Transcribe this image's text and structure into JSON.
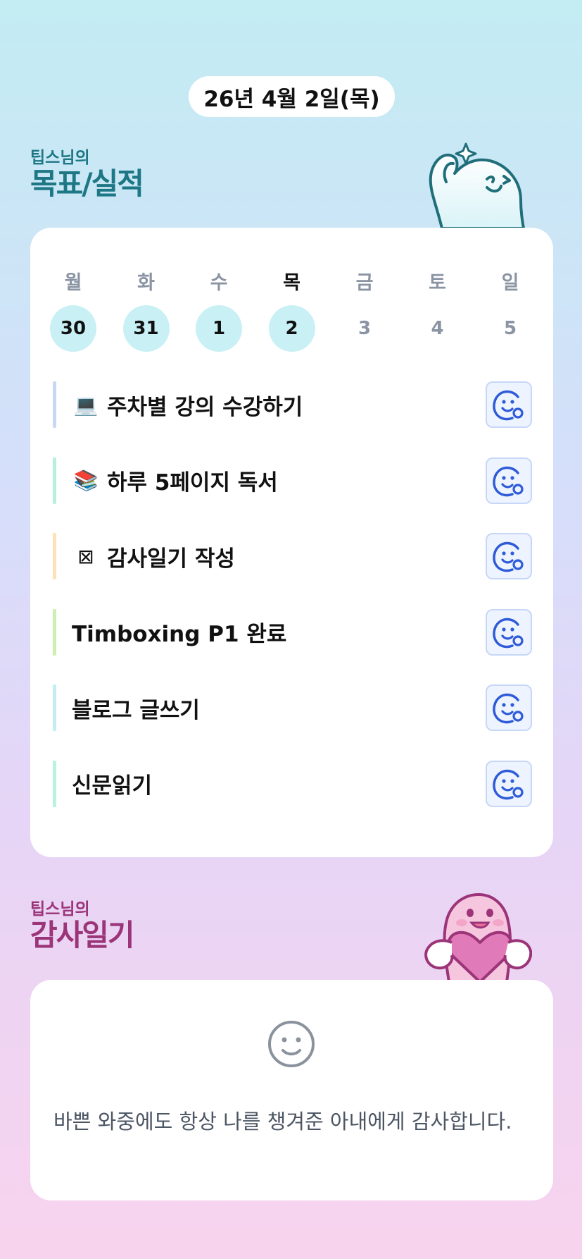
{
  "header": {
    "date": "26년 4월 2일(목)"
  },
  "goals_section": {
    "sub": "팁스님의",
    "title": "목표/실적"
  },
  "week": {
    "days": [
      {
        "name": "월",
        "num": "30",
        "done": true,
        "today": false
      },
      {
        "name": "화",
        "num": "31",
        "done": true,
        "today": false
      },
      {
        "name": "수",
        "num": "1",
        "done": true,
        "today": false
      },
      {
        "name": "목",
        "num": "2",
        "done": true,
        "today": true
      },
      {
        "name": "금",
        "num": "3",
        "done": false,
        "today": false
      },
      {
        "name": "토",
        "num": "4",
        "done": false,
        "today": false
      },
      {
        "name": "일",
        "num": "5",
        "done": false,
        "today": false
      }
    ]
  },
  "tasks": [
    {
      "icon": "💻",
      "icon_name": "laptop-icon",
      "label": "주차별 강의 수강하기",
      "color": "#c9d7f5"
    },
    {
      "icon": "📚",
      "icon_name": "books-icon",
      "label": "하루 5페이지 독서",
      "color": "#b7f0dc"
    },
    {
      "icon": "⊠",
      "icon_name": "missing-glyph-icon",
      "label": "감사일기 작성",
      "color": "#fde2b8"
    },
    {
      "icon": "",
      "icon_name": "",
      "label": "Timboxing P1 완료",
      "color": "#cdf0b0"
    },
    {
      "icon": "",
      "icon_name": "",
      "label": "블로그 글쓰기",
      "color": "#c3eef6"
    },
    {
      "icon": "",
      "icon_name": "",
      "label": "신문읽기",
      "color": "#b9f2dd"
    }
  ],
  "gratitude_section": {
    "sub": "팁스님의",
    "title": "감사일기"
  },
  "gratitude": {
    "text": "바쁜 와중에도 항상 나를 챙겨준 아내에게 감사합니다."
  },
  "colors": {
    "goal_title": "#1d7784",
    "gratitude_title": "#9b3478",
    "mood_icon": "#2f5bd9"
  }
}
